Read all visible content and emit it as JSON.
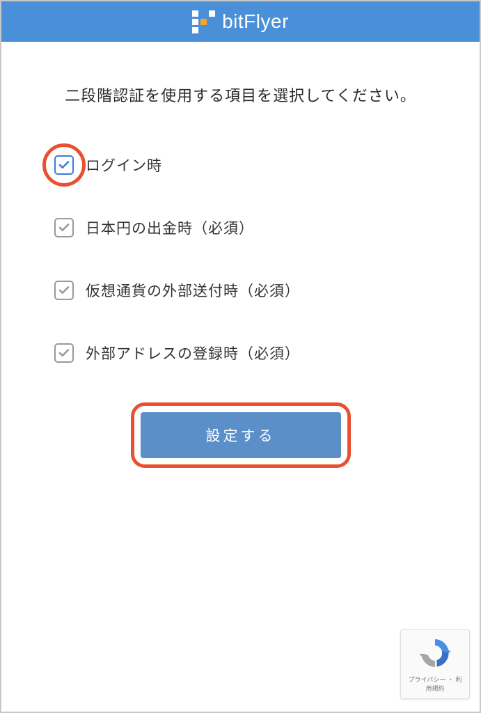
{
  "header": {
    "brand": "bitFlyer"
  },
  "content": {
    "title": "二段階認証を使用する項目を選択してください。",
    "options": [
      {
        "label": "ログイン時",
        "checked": true,
        "required": false,
        "highlighted": true
      },
      {
        "label": "日本円の出金時（必須）",
        "checked": true,
        "required": true,
        "highlighted": false
      },
      {
        "label": "仮想通貨の外部送付時（必須）",
        "checked": true,
        "required": true,
        "highlighted": false
      },
      {
        "label": "外部アドレスの登録時（必須）",
        "checked": true,
        "required": true,
        "highlighted": false
      }
    ],
    "submit_label": "設定する"
  },
  "recaptcha": {
    "footer": "プライバシー ・ 利用規約"
  },
  "colors": {
    "primary": "#4a90d9",
    "button": "#5b8fc7",
    "highlight": "#e8502f",
    "checkbox_active": "#3b7dd8",
    "checkbox_disabled": "#999"
  }
}
